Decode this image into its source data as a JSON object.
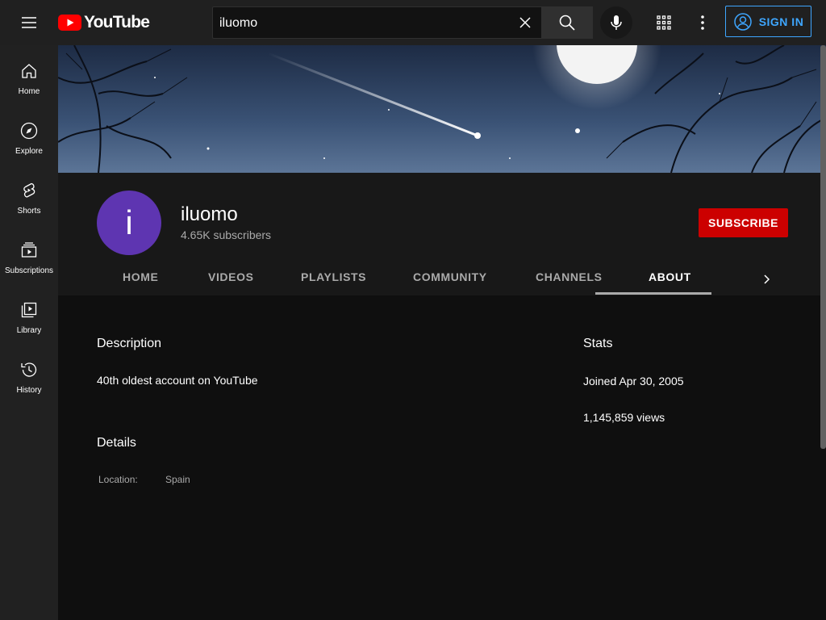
{
  "topbar": {
    "logo_text": "YouTube",
    "search_value": "iluomo",
    "search_placeholder": "Search",
    "signin_label": "SIGN IN"
  },
  "sidebar": {
    "items": [
      {
        "label": "Home",
        "icon": "home-icon"
      },
      {
        "label": "Explore",
        "icon": "compass-icon"
      },
      {
        "label": "Shorts",
        "icon": "shorts-icon"
      },
      {
        "label": "Subscriptions",
        "icon": "subscriptions-icon"
      },
      {
        "label": "Library",
        "icon": "library-icon"
      },
      {
        "label": "History",
        "icon": "history-icon"
      }
    ]
  },
  "channel": {
    "avatar_letter": "i",
    "name": "iluomo",
    "subscribers": "4.65K subscribers",
    "subscribe_label": "SUBSCRIBE",
    "tabs": [
      "HOME",
      "VIDEOS",
      "PLAYLISTS",
      "COMMUNITY",
      "CHANNELS",
      "ABOUT"
    ],
    "active_tab": "ABOUT"
  },
  "about": {
    "description_title": "Description",
    "description_text": "40th oldest account on YouTube",
    "details_title": "Details",
    "location_label": "Location:",
    "location_value": "Spain",
    "stats_title": "Stats",
    "joined": "Joined Apr 30, 2005",
    "views": "1,145,859 views"
  },
  "colors": {
    "background": "#0f0f0f",
    "header": "#202020",
    "accent_blue": "#3ea6ff",
    "subscribe_red": "#cc0000",
    "avatar_purple": "#5e35b1"
  }
}
